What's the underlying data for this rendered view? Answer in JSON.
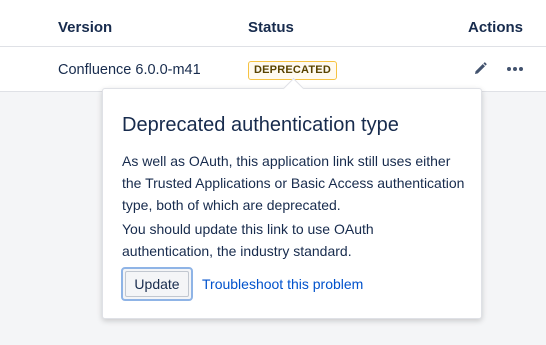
{
  "table": {
    "headers": {
      "version": "Version",
      "status": "Status",
      "actions": "Actions"
    },
    "rows": [
      {
        "version": "Confluence 6.0.0-m41",
        "status": "DEPRECATED",
        "actions": [
          "pencil-icon",
          "more-icon"
        ]
      }
    ]
  },
  "popup": {
    "title": "Deprecated authentication type",
    "paragraphs": [
      "As well as OAuth, this application link still uses either the Trusted Applications or Basic Access authentication type, both of which are deprecated.",
      "You should update this link to use OAuth authentication, the industry standard."
    ],
    "update_label": "Update",
    "troubleshoot_label": "Troubleshoot this problem"
  },
  "colors": {
    "lozenge_border": "#f6c342",
    "lozenge_text": "#594300",
    "link": "#0052cc",
    "text": "#172b4d",
    "focus_ring": "#8fb4e6"
  }
}
